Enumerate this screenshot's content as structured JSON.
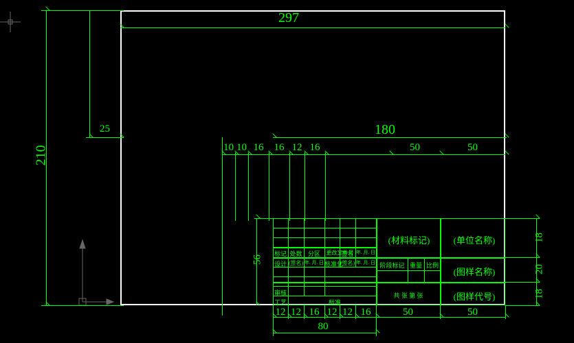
{
  "frame": {
    "width_label": "297",
    "height_label": "210",
    "left_margin_label": "25"
  },
  "title_block": {
    "total_width_label": "180",
    "total_height_label": "56",
    "left_group_width_label": "80",
    "top_cols": [
      "10",
      "10",
      "16",
      "16",
      "12",
      "16",
      "50",
      "50"
    ],
    "bottom_cols": [
      "12",
      "12",
      "16",
      "12",
      "12",
      "16",
      "50",
      "50"
    ],
    "right_rows": [
      "18",
      "20",
      "18"
    ],
    "cells": {
      "material": "(材料标记)",
      "company": "(单位名称)",
      "drawing_name": "(图样名称)",
      "drawing_no": "(图样代号)",
      "stage": "阶段标记",
      "weight": "重量",
      "scale": "比例",
      "sheets": "共    张    第    张",
      "r1": [
        "标记",
        "处数",
        "分区",
        "更改文件号",
        "签名",
        "年. 月. 日"
      ],
      "r2": [
        "设计",
        "(签名)",
        "年. 月. 日",
        "标准化",
        "(签名)",
        "年. 月. 日"
      ],
      "r3a": "审核",
      "r3b": "工艺",
      "r3c": "标准"
    }
  }
}
